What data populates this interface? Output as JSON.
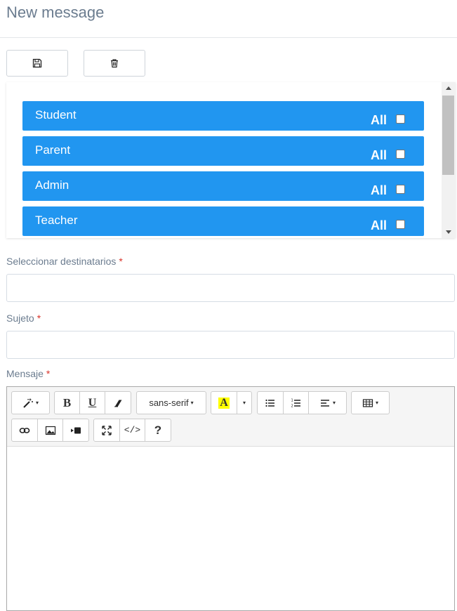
{
  "page": {
    "title": "New message"
  },
  "actions": {
    "save_icon": "floppy-icon",
    "delete_icon": "trash-icon"
  },
  "roles": {
    "items": [
      {
        "label": "Student",
        "all_label": "All",
        "checked": false
      },
      {
        "label": "Parent",
        "all_label": "All",
        "checked": false
      },
      {
        "label": "Admin",
        "all_label": "All",
        "checked": false
      },
      {
        "label": "Teacher",
        "all_label": "All",
        "checked": false
      }
    ],
    "color": "#2196f0"
  },
  "form": {
    "recipients": {
      "label": "Seleccionar destinatarios",
      "required_mark": "*",
      "value": ""
    },
    "subject": {
      "label": "Sujeto",
      "required_mark": "*",
      "value": ""
    },
    "message": {
      "label": "Mensaje",
      "required_mark": "*",
      "value": ""
    }
  },
  "editor": {
    "font_name": "sans-serif",
    "color_glyph": "A",
    "bold_glyph": "B",
    "underline_glyph": "U",
    "code_glyph": "</>",
    "help_glyph": "?",
    "caret_glyph": "▾",
    "icons": [
      "magic-wand-icon",
      "bold-icon",
      "underline-icon",
      "eraser-icon",
      "font-family-dropdown",
      "highlight-icon",
      "unordered-list-icon",
      "ordered-list-icon",
      "align-icon",
      "table-icon",
      "link-icon",
      "image-icon",
      "video-icon",
      "fullscreen-icon",
      "code-view-icon",
      "help-icon"
    ]
  },
  "colors": {
    "title": "#6b7c8f",
    "required": "#d9342b",
    "accent": "#2196f0",
    "highlight": "#ffff00"
  }
}
